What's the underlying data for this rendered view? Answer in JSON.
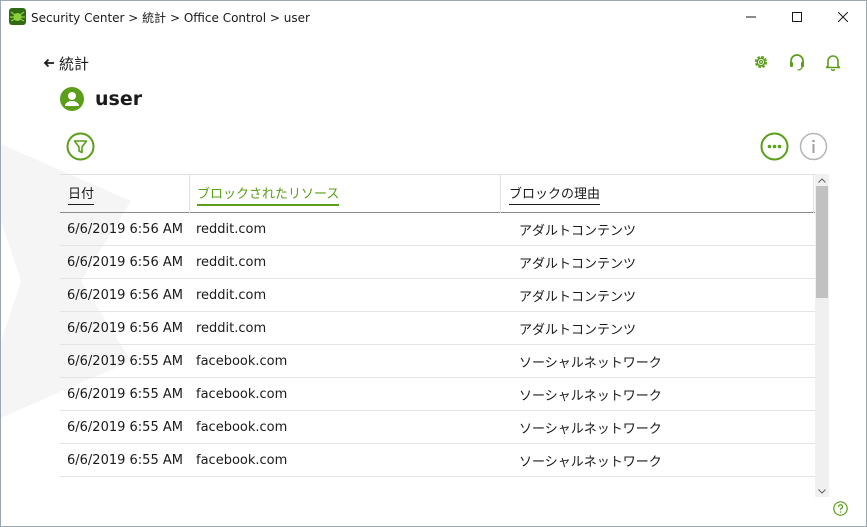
{
  "window": {
    "title": "Security Center > 統計 > Office Control > user",
    "app_icon": "drweb-spider-icon",
    "controls": [
      "minimize-icon",
      "maximize-icon",
      "close-icon"
    ]
  },
  "nav": {
    "back_label": "統計"
  },
  "header_icons": [
    "gear-icon",
    "headset-icon",
    "bell-icon"
  ],
  "user": {
    "name": "user",
    "avatar_icon": "user-avatar-icon"
  },
  "toolbar": {
    "filter_icon": "filter-icon",
    "more_icon": "more-icon",
    "info_icon": "info-icon"
  },
  "table": {
    "columns": [
      "日付",
      "ブロックされたリソース",
      "ブロックの理由"
    ],
    "sorted_column": "ブロックされたリソース",
    "rows": [
      {
        "date": "6/6/2019 6:56 AM",
        "resource": "reddit.com",
        "reason": "アダルトコンテンツ"
      },
      {
        "date": "6/6/2019 6:56 AM",
        "resource": "reddit.com",
        "reason": "アダルトコンテンツ"
      },
      {
        "date": "6/6/2019 6:56 AM",
        "resource": "reddit.com",
        "reason": "アダルトコンテンツ"
      },
      {
        "date": "6/6/2019 6:56 AM",
        "resource": "reddit.com",
        "reason": "アダルトコンテンツ"
      },
      {
        "date": "6/6/2019 6:55 AM",
        "resource": "facebook.com",
        "reason": "ソーシャルネットワーク"
      },
      {
        "date": "6/6/2019 6:55 AM",
        "resource": "facebook.com",
        "reason": "ソーシャルネットワーク"
      },
      {
        "date": "6/6/2019 6:55 AM",
        "resource": "facebook.com",
        "reason": "ソーシャルネットワーク"
      },
      {
        "date": "6/6/2019 6:55 AM",
        "resource": "facebook.com",
        "reason": "ソーシャルネットワーク"
      }
    ]
  },
  "colors": {
    "accent": "#5a9e1a",
    "text": "#1a1a1a",
    "muted_icon": "#9a9a9a"
  },
  "help_icon": "help-icon"
}
